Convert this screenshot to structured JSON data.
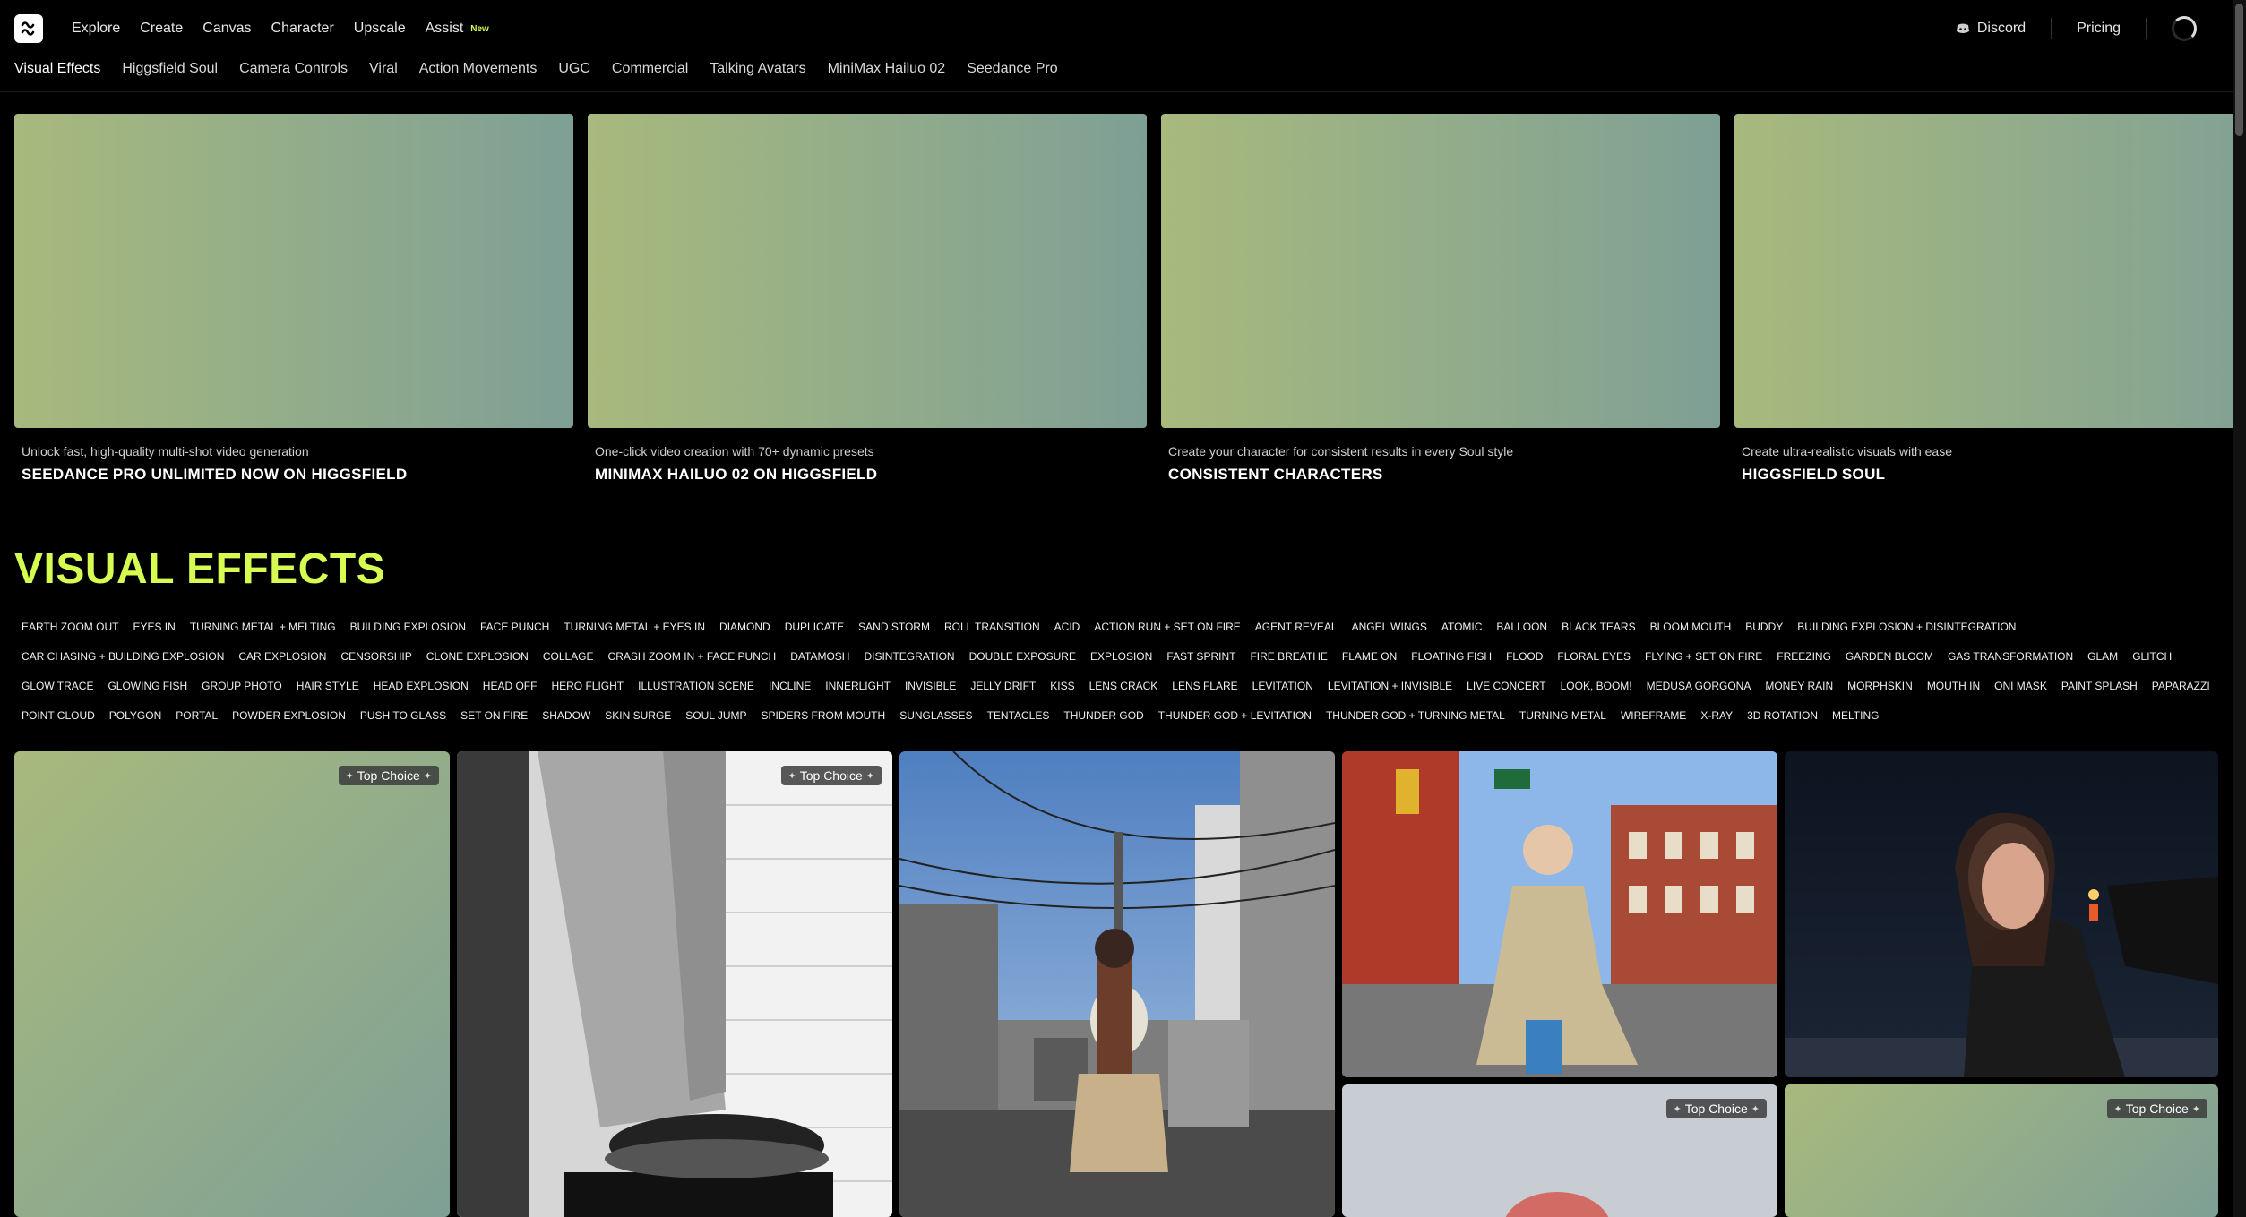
{
  "nav": {
    "main": [
      "Explore",
      "Create",
      "Canvas",
      "Character",
      "Upscale",
      "Assist"
    ],
    "assist_badge": "New",
    "discord": "Discord",
    "pricing": "Pricing"
  },
  "subnav": [
    "Visual Effects",
    "Higgsfield Soul",
    "Camera Controls",
    "Viral",
    "Action Movements",
    "UGC",
    "Commercial",
    "Talking Avatars",
    "MiniMax Hailuo 02",
    "Seedance Pro"
  ],
  "hero": [
    {
      "subtitle": "Unlock fast, high-quality multi-shot video generation",
      "title": "SEEDANCE PRO UNLIMITED NOW ON HIGGSFIELD"
    },
    {
      "subtitle": "One-click video creation with 70+ dynamic presets",
      "title": "MINIMAX HAILUO 02 ON HIGGSFIELD"
    },
    {
      "subtitle": "Create your character for consistent results in every Soul style",
      "title": "CONSISTENT CHARACTERS"
    },
    {
      "subtitle": "Create ultra-realistic visuals with ease",
      "title": "HIGGSFIELD SOUL"
    }
  ],
  "section_title": "VISUAL EFFECTS",
  "tags": [
    "EARTH ZOOM OUT",
    "EYES IN",
    "TURNING METAL + MELTING",
    "BUILDING EXPLOSION",
    "FACE PUNCH",
    "TURNING METAL + EYES IN",
    "DIAMOND",
    "DUPLICATE",
    "SAND STORM",
    "ROLL TRANSITION",
    "ACID",
    "ACTION RUN + SET ON FIRE",
    "AGENT REVEAL",
    "ANGEL WINGS",
    "ATOMIC",
    "BALLOON",
    "BLACK TEARS",
    "BLOOM MOUTH",
    "BUDDY",
    "BUILDING EXPLOSION + DISINTEGRATION",
    "CAR CHASING + BUILDING EXPLOSION",
    "CAR EXPLOSION",
    "CENSORSHIP",
    "CLONE EXPLOSION",
    "COLLAGE",
    "CRASH ZOOM IN + FACE PUNCH",
    "DATAMOSH",
    "DISINTEGRATION",
    "DOUBLE EXPOSURE",
    "EXPLOSION",
    "FAST SPRINT",
    "FIRE BREATHE",
    "FLAME ON",
    "FLOATING FISH",
    "FLOOD",
    "FLORAL EYES",
    "FLYING + SET ON FIRE",
    "FREEZING",
    "GARDEN BLOOM",
    "GAS TRANSFORMATION",
    "GLAM",
    "GLITCH",
    "GLOW TRACE",
    "GLOWING FISH",
    "GROUP PHOTO",
    "HAIR STYLE",
    "HEAD EXPLOSION",
    "HEAD OFF",
    "HERO FLIGHT",
    "ILLUSTRATION SCENE",
    "INCLINE",
    "INNERLIGHT",
    "INVISIBLE",
    "JELLY DRIFT",
    "KISS",
    "LENS CRACK",
    "LENS FLARE",
    "LEVITATION",
    "LEVITATION + INVISIBLE",
    "LIVE CONCERT",
    "LOOK, BOOM!",
    "MEDUSA GORGONA",
    "MONEY RAIN",
    "MORPHSKIN",
    "MOUTH IN",
    "ONI MASK",
    "PAINT SPLASH",
    "PAPARAZZI",
    "POINT CLOUD",
    "POLYGON",
    "PORTAL",
    "POWDER EXPLOSION",
    "PUSH TO GLASS",
    "SET ON FIRE",
    "SHADOW",
    "SKIN SURGE",
    "SOUL JUMP",
    "SPIDERS FROM MOUTH",
    "SUNGLASSES",
    "TENTACLES",
    "THUNDER GOD",
    "THUNDER GOD + LEVITATION",
    "THUNDER GOD + TURNING METAL",
    "TURNING METAL",
    "WIREFRAME",
    "X-RAY",
    "3D ROTATION",
    "MELTING"
  ],
  "badges": {
    "top_choice": "Top Choice"
  },
  "colors": {
    "accent": "#d6fc51",
    "background": "#000000"
  }
}
